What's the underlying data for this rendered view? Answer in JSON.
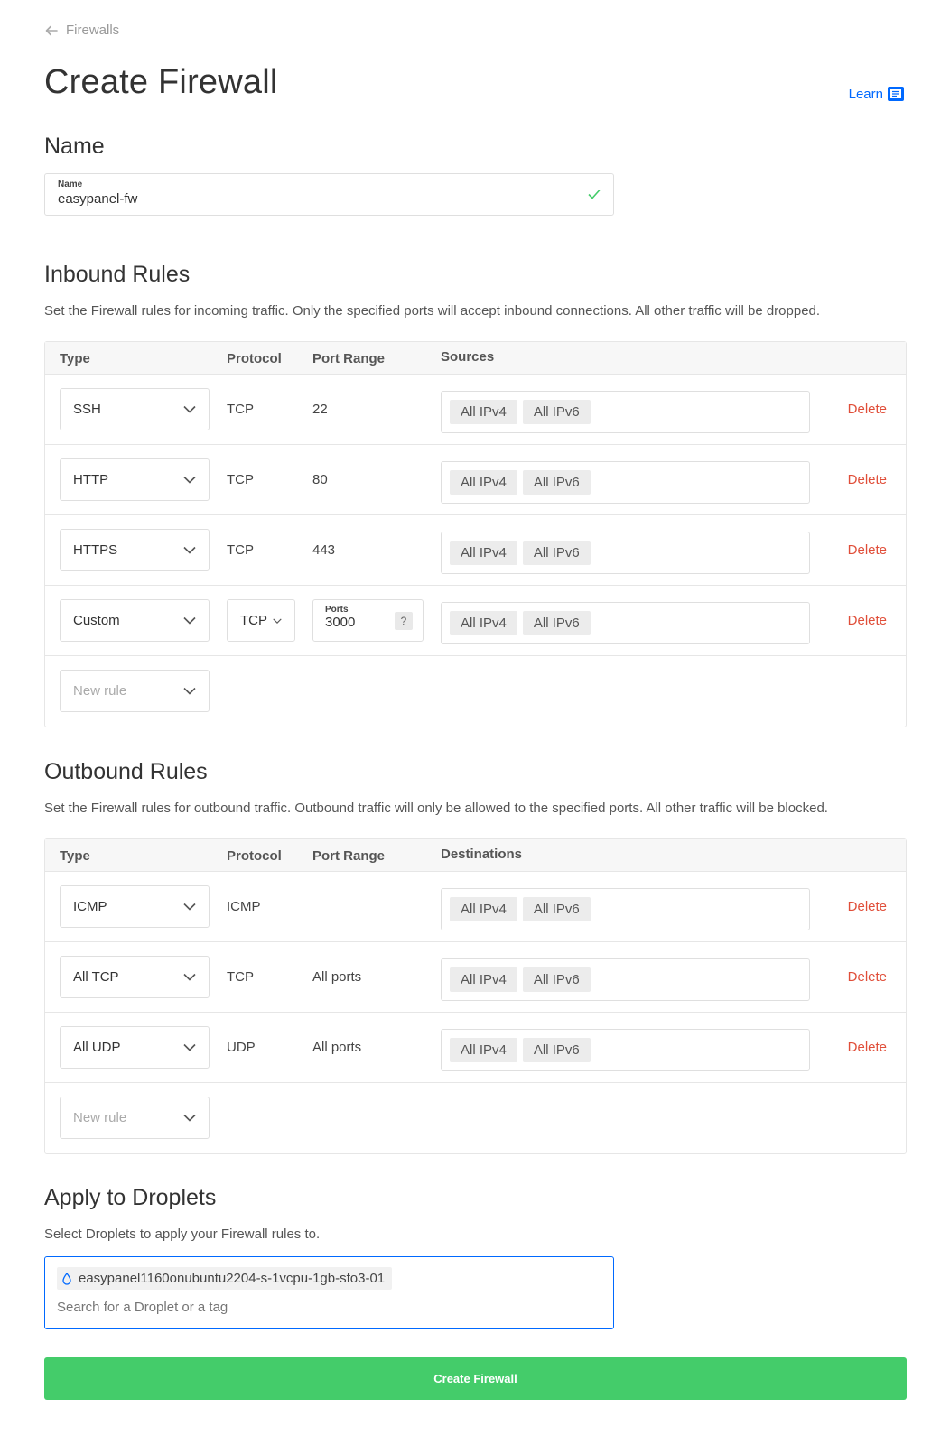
{
  "breadcrumb": {
    "label": "Firewalls"
  },
  "page": {
    "title": "Create Firewall",
    "learn_label": "Learn"
  },
  "name_section": {
    "title": "Name",
    "field_label": "Name",
    "field_value": "easypanel-fw"
  },
  "inbound": {
    "title": "Inbound Rules",
    "description": "Set the Firewall rules for incoming traffic. Only the specified ports will accept inbound connections. All other traffic will be dropped.",
    "headers": {
      "type": "Type",
      "protocol": "Protocol",
      "port_range": "Port Range",
      "sources": "Sources"
    },
    "rows": [
      {
        "type": "SSH",
        "protocol": "TCP",
        "port": "22",
        "tags": [
          "All IPv4",
          "All IPv6"
        ],
        "delete": "Delete"
      },
      {
        "type": "HTTP",
        "protocol": "TCP",
        "port": "80",
        "tags": [
          "All IPv4",
          "All IPv6"
        ],
        "delete": "Delete"
      },
      {
        "type": "HTTPS",
        "protocol": "TCP",
        "port": "443",
        "tags": [
          "All IPv4",
          "All IPv6"
        ],
        "delete": "Delete"
      },
      {
        "type": "Custom",
        "protocol": "TCP",
        "ports_label": "Ports",
        "port": "3000",
        "help": "?",
        "tags": [
          "All IPv4",
          "All IPv6"
        ],
        "delete": "Delete"
      }
    ],
    "new_rule_placeholder": "New rule"
  },
  "outbound": {
    "title": "Outbound Rules",
    "description": "Set the Firewall rules for outbound traffic. Outbound traffic will only be allowed to the specified ports. All other traffic will be blocked.",
    "headers": {
      "type": "Type",
      "protocol": "Protocol",
      "port_range": "Port Range",
      "destinations": "Destinations"
    },
    "rows": [
      {
        "type": "ICMP",
        "protocol": "ICMP",
        "port": "",
        "tags": [
          "All IPv4",
          "All IPv6"
        ],
        "delete": "Delete"
      },
      {
        "type": "All TCP",
        "protocol": "TCP",
        "port": "All ports",
        "tags": [
          "All IPv4",
          "All IPv6"
        ],
        "delete": "Delete"
      },
      {
        "type": "All UDP",
        "protocol": "UDP",
        "port": "All ports",
        "tags": [
          "All IPv4",
          "All IPv6"
        ],
        "delete": "Delete"
      }
    ],
    "new_rule_placeholder": "New rule"
  },
  "droplets": {
    "title": "Apply to Droplets",
    "description": "Select Droplets to apply your Firewall rules to.",
    "selected": "easypanel1160onubuntu2204-s-1vcpu-1gb-sfo3-01",
    "search_placeholder": "Search for a Droplet or a tag"
  },
  "submit": {
    "label": "Create Firewall"
  },
  "colors": {
    "accent": "#0069ff",
    "success": "#44cc6a",
    "danger": "#e04e39"
  }
}
